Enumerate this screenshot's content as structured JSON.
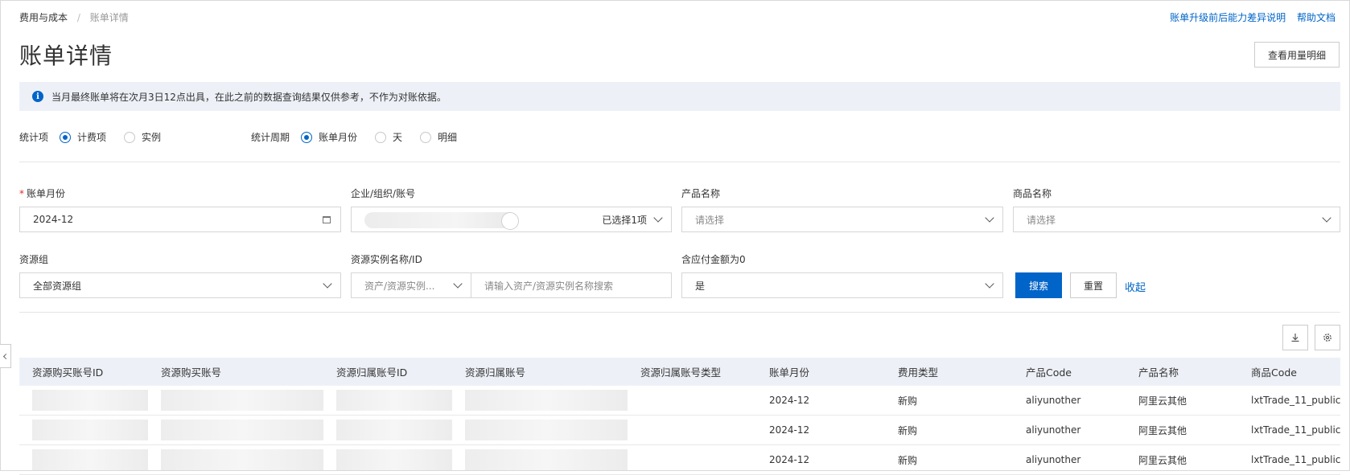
{
  "breadcrumb": {
    "parent": "费用与成本",
    "separator": "/",
    "current": "账单详情"
  },
  "top_links": {
    "compare": "账单升级前后能力差异说明",
    "help": "帮助文档"
  },
  "page_title": "账单详情",
  "usage_button": "查看用量明细",
  "notice": {
    "icon": "info-icon",
    "text": "当月最终账单将在次月3日12点出具，在此之前的数据查询结果仅供参考，不作为对账依据。"
  },
  "stat_item": {
    "label": "统计项",
    "options": [
      "计费项",
      "实例"
    ],
    "selected": "计费项"
  },
  "stat_period": {
    "label": "统计周期",
    "options": [
      "账单月份",
      "天",
      "明细"
    ],
    "selected": "账单月份"
  },
  "filters": {
    "bill_month": {
      "label": "账单月份",
      "value": "2024-12"
    },
    "account": {
      "label": "企业/组织/账号",
      "selected_text": "已选择1项"
    },
    "product_name": {
      "label": "产品名称",
      "placeholder": "请选择"
    },
    "commodity_name": {
      "label": "商品名称",
      "placeholder": "请选择"
    },
    "resource_group": {
      "label": "资源组",
      "value": "全部资源组"
    },
    "resource_instance": {
      "label": "资源实例名称/ID",
      "type_value": "资产/资源实例...",
      "placeholder": "请输入资产/资源实例名称搜索"
    },
    "zero_payable": {
      "label": "含应付金额为0",
      "value": "是"
    }
  },
  "actions": {
    "search": "搜索",
    "reset": "重置",
    "collapse": "收起"
  },
  "table": {
    "columns": [
      "资源购买账号ID",
      "资源购买账号",
      "资源归属账号ID",
      "资源归属账号",
      "资源归属账号类型",
      "账单月份",
      "费用类型",
      "产品Code",
      "产品名称",
      "商品Code"
    ],
    "rows": [
      {
        "bill_month": "2024-12",
        "fee_type": "新购",
        "product_code": "aliyunother",
        "product_name": "阿里云其他",
        "commodity_code": "lxtTrade_11_public..."
      },
      {
        "bill_month": "2024-12",
        "fee_type": "新购",
        "product_code": "aliyunother",
        "product_name": "阿里云其他",
        "commodity_code": "lxtTrade_11_public..."
      },
      {
        "bill_month": "2024-12",
        "fee_type": "新购",
        "product_code": "aliyunother",
        "product_name": "阿里云其他",
        "commodity_code": "lxtTrade_11_public..."
      }
    ]
  },
  "colors": {
    "primary": "#0064c8",
    "notice_bg": "#edf1f7",
    "header_bg": "#edf1f7"
  }
}
